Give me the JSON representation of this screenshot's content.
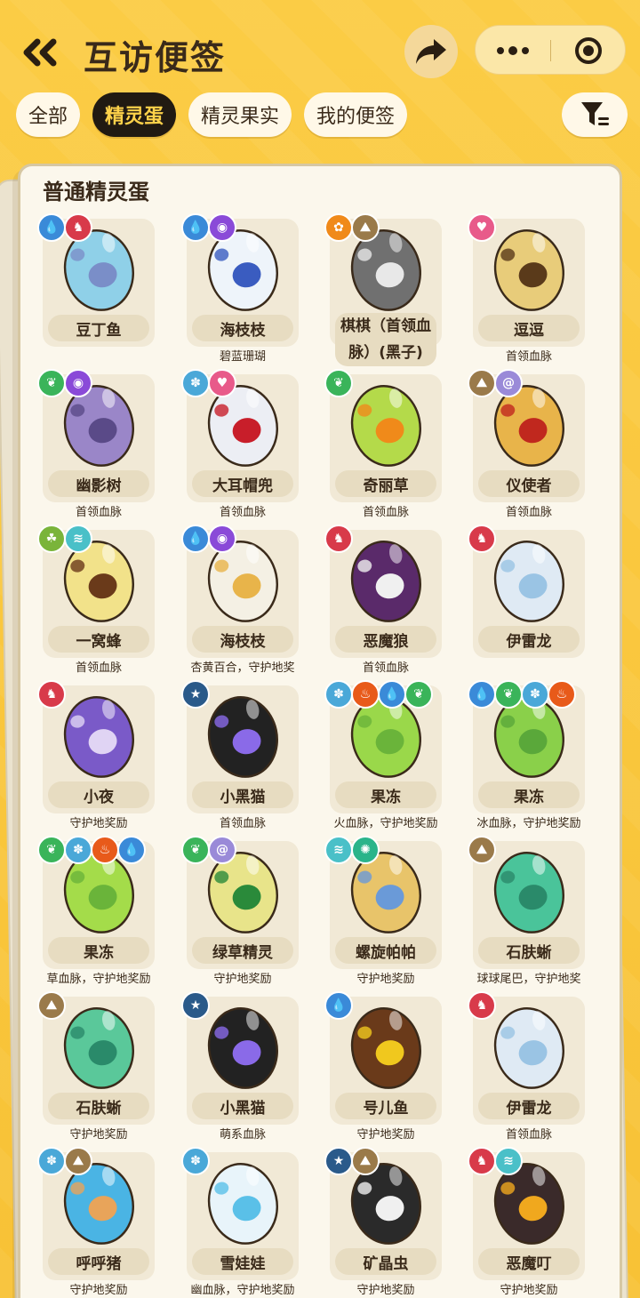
{
  "header": {
    "title": "互访便签"
  },
  "tabs": [
    {
      "label": "全部",
      "active": false
    },
    {
      "label": "精灵蛋",
      "active": true
    },
    {
      "label": "精灵果实",
      "active": false
    },
    {
      "label": "我的便签",
      "active": false
    }
  ],
  "section_title": "普通精灵蛋",
  "colors": {
    "accent": "#f9c53a",
    "tab_active_bg": "#211a12",
    "tab_active_text": "#ffd24a"
  },
  "eggs": [
    {
      "name": "豆丁鱼",
      "sub": "",
      "badges": [
        "water-icon",
        "fire-demon-icon"
      ],
      "colors": [
        "#8fd0e8",
        "#7a8ec8"
      ]
    },
    {
      "name": "海枝枝",
      "sub": "碧蓝珊瑚",
      "badges": [
        "water-icon",
        "ghost-icon"
      ],
      "colors": [
        "#eef4fa",
        "#3a5cc0"
      ]
    },
    {
      "name": "棋棋（首领血脉）(黑子)",
      "sub": "",
      "badges": [
        "light-icon",
        "ground-icon"
      ],
      "colors": [
        "#707070",
        "#e8e8e8"
      ]
    },
    {
      "name": "逗逗",
      "sub": "首领血脉",
      "badges": [
        "cute-icon"
      ],
      "colors": [
        "#e8cc7a",
        "#5a3a1a"
      ]
    },
    {
      "name": "幽影树",
      "sub": "首领血脉",
      "badges": [
        "grass-icon",
        "ghost-icon"
      ],
      "colors": [
        "#9a86c8",
        "#5a4a88"
      ]
    },
    {
      "name": "大耳帽兜",
      "sub": "首领血脉",
      "badges": [
        "ice-icon",
        "cute-icon"
      ],
      "colors": [
        "#eceef4",
        "#c81e2a"
      ]
    },
    {
      "name": "奇丽草",
      "sub": "首领血脉",
      "badges": [
        "grass-icon"
      ],
      "colors": [
        "#b4da4a",
        "#f08a1a"
      ]
    },
    {
      "name": "仪使者",
      "sub": "首领血脉",
      "badges": [
        "ground-icon",
        "wind-icon"
      ],
      "colors": [
        "#e8b44a",
        "#c0281e"
      ]
    },
    {
      "name": "一窝蜂",
      "sub": "首领血脉",
      "badges": [
        "bug-icon",
        "wing-icon"
      ],
      "colors": [
        "#f2e28a",
        "#6a3a1a"
      ]
    },
    {
      "name": "海枝枝",
      "sub": "杏黄百合，守护地奖",
      "badges": [
        "water-icon",
        "ghost-icon"
      ],
      "colors": [
        "#f4f0e4",
        "#e8b44a"
      ]
    },
    {
      "name": "恶魔狼",
      "sub": "首领血脉",
      "badges": [
        "fire-demon-icon"
      ],
      "colors": [
        "#5a2a6a",
        "#f0f0f0"
      ]
    },
    {
      "name": "伊雷龙",
      "sub": "",
      "badges": [
        "fire-demon-icon"
      ],
      "colors": [
        "#dfeaf4",
        "#9ac4e4"
      ]
    },
    {
      "name": "小夜",
      "sub": "守护地奖励",
      "badges": [
        "fire-demon-icon"
      ],
      "colors": [
        "#7a5ac8",
        "#e0d4f4"
      ]
    },
    {
      "name": "小黑猫",
      "sub": "首领血脉",
      "badges": [
        "star-icon"
      ],
      "colors": [
        "#222222",
        "#8a6ae8"
      ]
    },
    {
      "name": "果冻",
      "sub": "火血脉，守护地奖励",
      "badges": [
        "ice-icon",
        "fire-icon",
        "water-icon",
        "grass-icon"
      ],
      "colors": [
        "#9ad84a",
        "#6ab43a"
      ]
    },
    {
      "name": "果冻",
      "sub": "冰血脉，守护地奖励",
      "badges": [
        "water-icon",
        "grass-icon",
        "ice-icon",
        "fire-icon"
      ],
      "colors": [
        "#8ad04a",
        "#5aa83a"
      ]
    },
    {
      "name": "果冻",
      "sub": "草血脉，守护地奖励",
      "badges": [
        "grass-icon",
        "ice-icon",
        "fire-icon",
        "water-icon"
      ],
      "colors": [
        "#a4dc4a",
        "#6ab43a"
      ]
    },
    {
      "name": "绿草精灵",
      "sub": "守护地奖励",
      "badges": [
        "grass-icon",
        "wind-icon"
      ],
      "colors": [
        "#e8e48a",
        "#2a8a3a"
      ]
    },
    {
      "name": "螺旋帕帕",
      "sub": "守护地奖励",
      "badges": [
        "wing-icon",
        "gear-icon"
      ],
      "colors": [
        "#e8c46a",
        "#6a9ad8"
      ]
    },
    {
      "name": "石肤蜥",
      "sub": "球球尾巴，守护地奖",
      "badges": [
        "ground-icon"
      ],
      "colors": [
        "#4ac49a",
        "#2a8a6a"
      ]
    },
    {
      "name": "石肤蜥",
      "sub": "守护地奖励",
      "badges": [
        "ground-icon"
      ],
      "colors": [
        "#5ac89a",
        "#2a8a6a"
      ]
    },
    {
      "name": "小黑猫",
      "sub": "萌系血脉",
      "badges": [
        "star-icon"
      ],
      "colors": [
        "#222222",
        "#8a6ae8"
      ]
    },
    {
      "name": "号儿鱼",
      "sub": "守护地奖励",
      "badges": [
        "water-icon"
      ],
      "colors": [
        "#6a3a1a",
        "#f0c81e"
      ]
    },
    {
      "name": "伊雷龙",
      "sub": "首领血脉",
      "badges": [
        "fire-demon-icon"
      ],
      "colors": [
        "#dfeaf4",
        "#9ac4e4"
      ]
    },
    {
      "name": "呼呼猪",
      "sub": "守护地奖励",
      "badges": [
        "ice-icon",
        "ground-icon"
      ],
      "colors": [
        "#4ab4e4",
        "#e8a45a"
      ]
    },
    {
      "name": "雪娃娃",
      "sub": "幽血脉，守护地奖励",
      "badges": [
        "ice-icon"
      ],
      "colors": [
        "#e8f4fa",
        "#5ac0e8"
      ]
    },
    {
      "name": "矿晶虫",
      "sub": "守护地奖励",
      "badges": [
        "star-icon",
        "ground-icon"
      ],
      "colors": [
        "#2a2a2a",
        "#f0f0f0"
      ]
    },
    {
      "name": "恶魔叮",
      "sub": "守护地奖励",
      "badges": [
        "fire-demon-icon",
        "wing-icon"
      ],
      "colors": [
        "#3a2a2a",
        "#f0a81e"
      ]
    }
  ]
}
